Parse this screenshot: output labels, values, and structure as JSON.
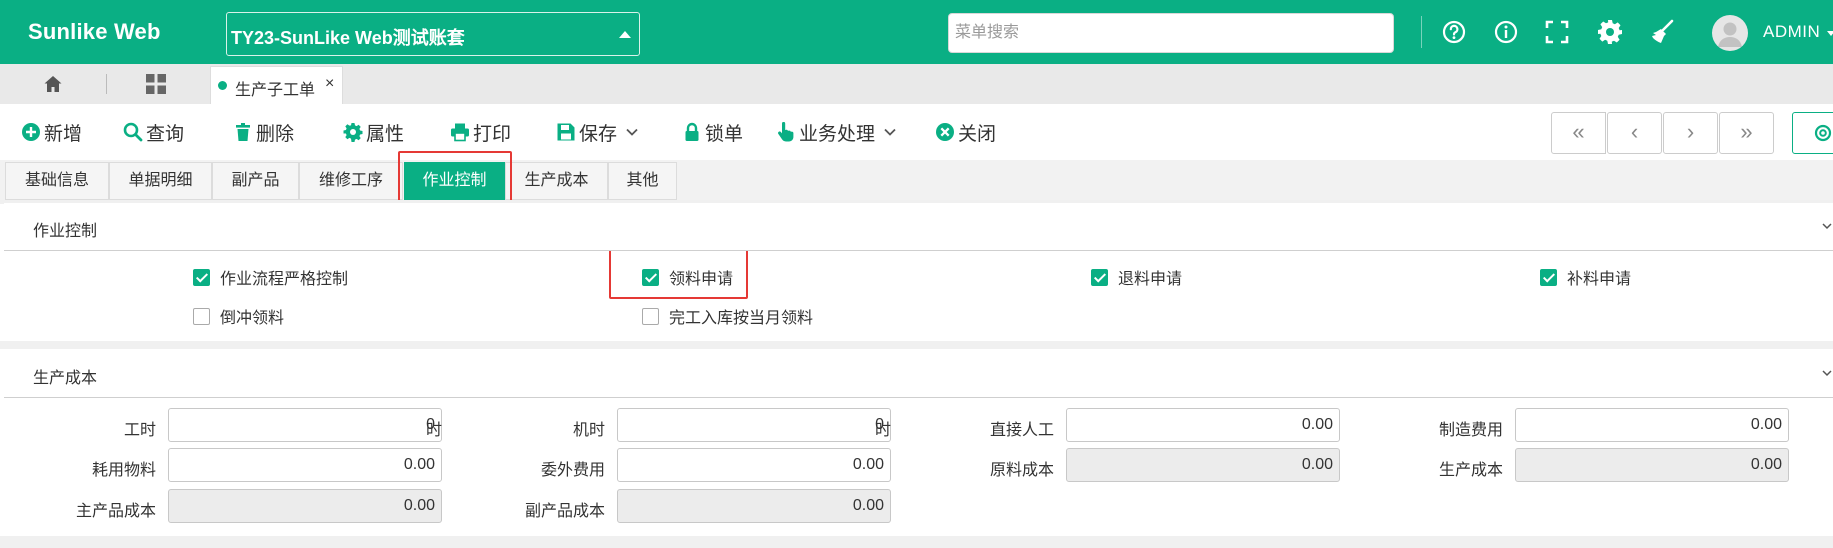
{
  "header": {
    "brand": "Sunlike Web",
    "company": "TY23-SunLike Web测试账套",
    "search_placeholder": "菜单搜索",
    "user": "ADMIN"
  },
  "tabstrip": {
    "open_tab": "生产子工单",
    "close_glyph": "×"
  },
  "toolbar": {
    "new": "新增",
    "query": "查询",
    "delete": "删除",
    "props": "属性",
    "print": "打印",
    "save": "保存",
    "lock": "锁单",
    "business": "业务处理",
    "close": "关闭",
    "pager_first": "«",
    "pager_prev": "‹",
    "pager_next": "›",
    "pager_last": "»"
  },
  "section_tabs": [
    "基础信息",
    "单据明细",
    "副产品",
    "维修工序",
    "作业控制",
    "生产成本",
    "其他"
  ],
  "active_section_tab": "作业控制",
  "work_control": {
    "title": "作业控制",
    "checks": [
      {
        "label": "作业流程严格控制",
        "checked": true
      },
      {
        "label": "领料申请",
        "checked": true
      },
      {
        "label": "退料申请",
        "checked": true
      },
      {
        "label": "补料申请",
        "checked": true
      },
      {
        "label": "倒冲领料",
        "checked": false
      },
      {
        "label": "完工入库按当月领料",
        "checked": false
      }
    ]
  },
  "production_cost": {
    "title": "生产成本",
    "fields": [
      {
        "label": "工时",
        "value": "0",
        "unit": "时",
        "readonly": false
      },
      {
        "label": "机时",
        "value": "0",
        "unit": "时",
        "readonly": false
      },
      {
        "label": "直接人工",
        "value": "0.00",
        "readonly": false
      },
      {
        "label": "制造费用",
        "value": "0.00",
        "readonly": false
      },
      {
        "label": "耗用物料",
        "value": "0.00",
        "readonly": false
      },
      {
        "label": "委外费用",
        "value": "0.00",
        "readonly": false
      },
      {
        "label": "原料成本",
        "value": "0.00",
        "readonly": true
      },
      {
        "label": "生产成本",
        "value": "0.00",
        "readonly": true
      },
      {
        "label": "主产品成本",
        "value": "0.00",
        "readonly": true
      },
      {
        "label": "副产品成本",
        "value": "0.00",
        "readonly": true
      }
    ]
  },
  "colors": {
    "primary": "#0aaf84",
    "highlight": "#e53935"
  }
}
